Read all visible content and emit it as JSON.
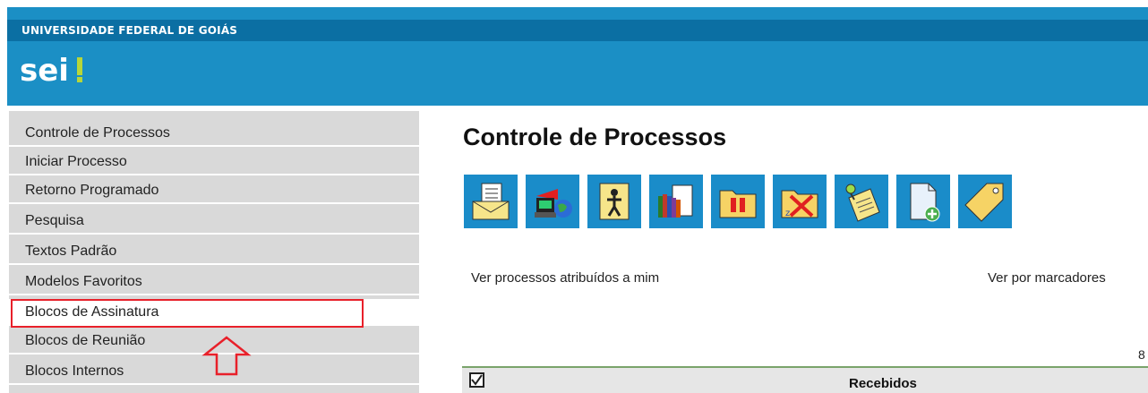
{
  "header": {
    "university": "UNIVERSIDADE FEDERAL DE GOIÁS",
    "logo_text": "sei!"
  },
  "sidebar": {
    "items": [
      {
        "label": "Controle de Processos"
      },
      {
        "label": "Iniciar Processo"
      },
      {
        "label": "Retorno Programado"
      },
      {
        "label": "Pesquisa"
      },
      {
        "label": "Textos Padrão"
      },
      {
        "label": "Modelos Favoritos"
      },
      {
        "label": "Blocos de Assinatura",
        "active": true
      },
      {
        "label": "Blocos de Reunião"
      },
      {
        "label": "Blocos Internos"
      }
    ]
  },
  "main": {
    "title": "Controle de Processos",
    "toolbar_icons": [
      "envelope-document-icon",
      "computer-globe-icon",
      "person-folder-icon",
      "books-document-icon",
      "pause-folder-icon",
      "cancel-folder-icon",
      "pinned-note-icon",
      "new-document-icon",
      "tag-icon"
    ],
    "link_assigned": "Ver processos atribuídos a mim",
    "link_markers": "Ver por marcadores",
    "count_fragment": "8",
    "table": {
      "received_header": "Recebidos"
    }
  },
  "colors": {
    "header_blue": "#1b8fc5",
    "header_band": "#0b6fa3",
    "toolbar_blue": "#1a8cc9",
    "highlight_red": "#e8202a"
  }
}
